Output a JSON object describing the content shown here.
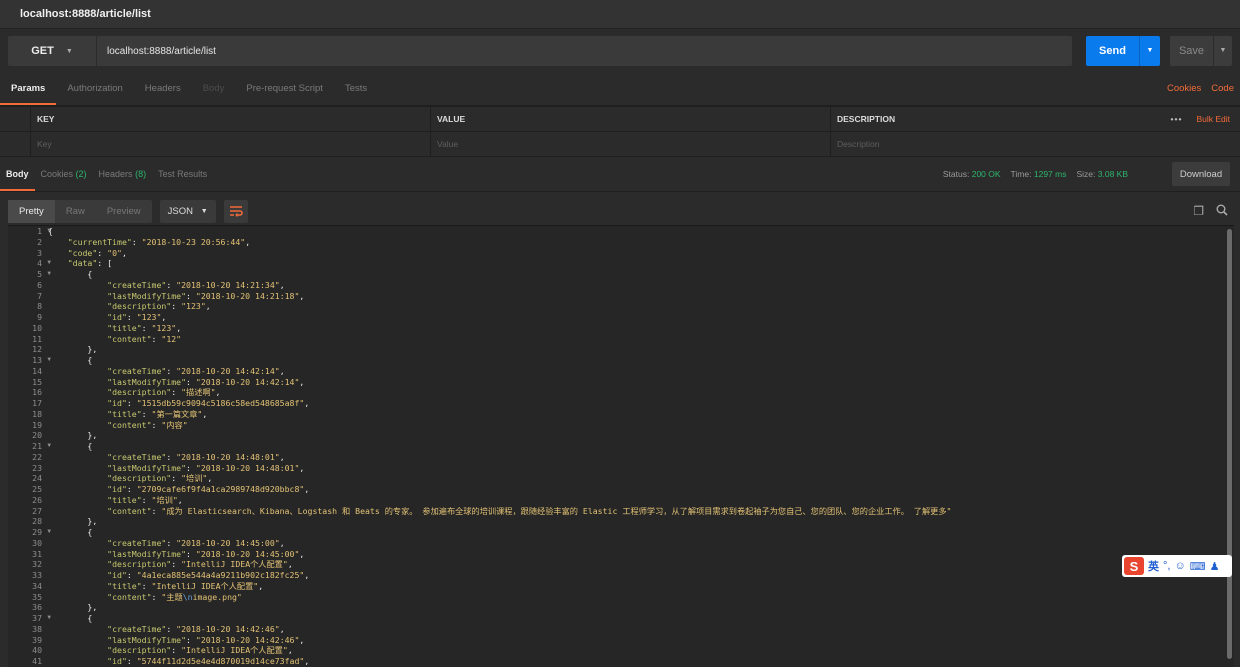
{
  "window": {
    "title": "localhost:8888/article/list"
  },
  "request": {
    "method": "GET",
    "url": "localhost:8888/article/list",
    "send_label": "Send",
    "save_label": "Save"
  },
  "request_tabs": [
    "Params",
    "Authorization",
    "Headers",
    "Body",
    "Pre-request Script",
    "Tests"
  ],
  "request_links": {
    "cookies": "Cookies",
    "code": "Code"
  },
  "params_table": {
    "headers": {
      "key": "KEY",
      "value": "VALUE",
      "description": "DESCRIPTION"
    },
    "bulk_edit": "Bulk Edit",
    "more": "•••",
    "placeholders": {
      "key": "Key",
      "value": "Value",
      "description": "Description"
    }
  },
  "response_tabs": {
    "body": "Body",
    "cookies": "Cookies",
    "cookies_count": "(2)",
    "headers": "Headers",
    "headers_count": "(8)",
    "test_results": "Test Results"
  },
  "response_status": {
    "status_label": "Status:",
    "status_value": "200 OK",
    "time_label": "Time:",
    "time_value": "1297 ms",
    "size_label": "Size:",
    "size_value": "3.08 KB",
    "download_label": "Download"
  },
  "view_modes": [
    "Pretty",
    "Raw",
    "Preview"
  ],
  "format": "JSON",
  "colors": {
    "accent": "#f26b3a",
    "send_blue": "#097bed",
    "ok_green": "#2db56c"
  },
  "code_lines": [
    "{",
    "    \"currentTime\": \"2018-10-23 20:56:44\",",
    "    \"code\": \"0\",",
    "    \"data\": [",
    "        {",
    "            \"createTime\": \"2018-10-20 14:21:34\",",
    "            \"lastModifyTime\": \"2018-10-20 14:21:18\",",
    "            \"description\": \"123\",",
    "            \"id\": \"123\",",
    "            \"title\": \"123\",",
    "            \"content\": \"12\"",
    "        },",
    "        {",
    "            \"createTime\": \"2018-10-20 14:42:14\",",
    "            \"lastModifyTime\": \"2018-10-20 14:42:14\",",
    "            \"description\": \"描述啊\",",
    "            \"id\": \"1515db59c9094c5186c58ed548685a8f\",",
    "            \"title\": \"第一篇文章\",",
    "            \"content\": \"内容\"",
    "        },",
    "        {",
    "            \"createTime\": \"2018-10-20 14:48:01\",",
    "            \"lastModifyTime\": \"2018-10-20 14:48:01\",",
    "            \"description\": \"培训\",",
    "            \"id\": \"2709cafe6f9f4a1ca2989748d920bbc8\",",
    "            \"title\": \"培训\",",
    "            \"content\": \"成为 Elasticsearch、Kibana、Logstash 和 Beats 的专家。 参加遍布全球的培训课程，跟随经验丰富的 Elastic 工程师学习，从了解项目需求到卷起袖子为您自己、您的团队、您的企业工作。 了解更多\"",
    "        },",
    "        {",
    "            \"createTime\": \"2018-10-20 14:45:00\",",
    "            \"lastModifyTime\": \"2018-10-20 14:45:00\",",
    "            \"description\": \"IntelliJ IDEA个人配置\",",
    "            \"id\": \"4a1eca885e544a4a9211b902c182fc25\",",
    "            \"title\": \"IntelliJ IDEA个人配置\",",
    "            \"content\": \"主题\\nimage.png\"",
    "        },",
    "        {",
    "            \"createTime\": \"2018-10-20 14:42:46\",",
    "            \"lastModifyTime\": \"2018-10-20 14:42:46\",",
    "            \"description\": \"IntelliJ IDEA个人配置\",",
    "            \"id\": \"5744f11d2d5e4e4d870019d14ce73fad\","
  ],
  "ime_toolbar": {
    "logo": "S",
    "mode": "英"
  }
}
